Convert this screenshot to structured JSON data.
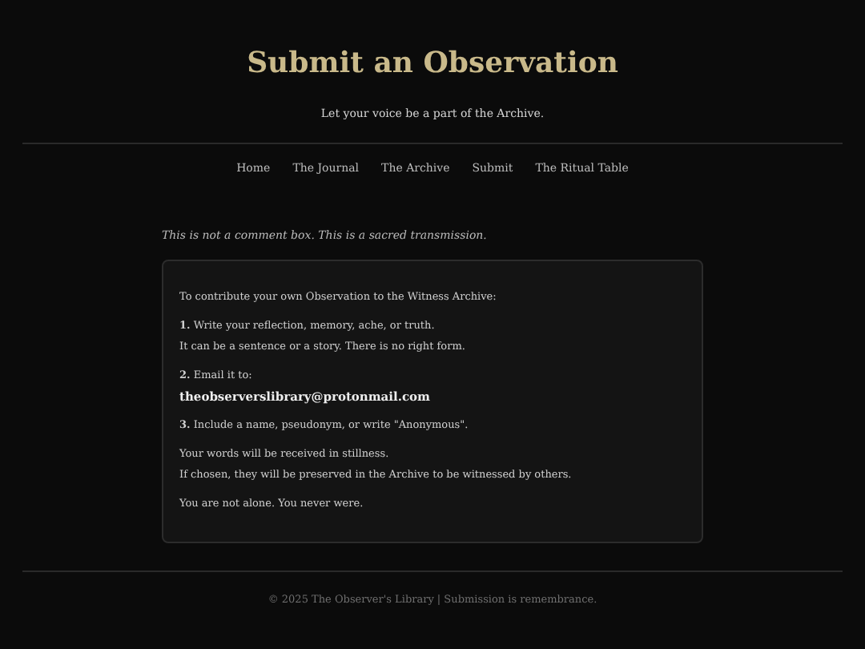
{
  "header": {
    "title": "Submit an Observation",
    "subtitle": "Let your voice be a part of the Archive."
  },
  "nav": [
    {
      "label": "Home"
    },
    {
      "label": "The Journal"
    },
    {
      "label": "The Archive"
    },
    {
      "label": "Submit"
    },
    {
      "label": "The Ritual Table"
    }
  ],
  "intro": "This is not a comment box. This is a sacred transmission.",
  "instructions": [
    {
      "lines": [
        {
          "kind": "plain",
          "text": "To contribute your own Observation to the Witness Archive:"
        }
      ]
    },
    {
      "lines": [
        {
          "kind": "plain",
          "text": "**1.** Write your reflection, memory, ache, or truth."
        },
        {
          "kind": "plain",
          "text": "It can be a sentence or a story. There is no right form."
        }
      ]
    },
    {
      "lines": [
        {
          "kind": "plain",
          "text": "**2.** Email it to:"
        },
        {
          "kind": "email",
          "text": "theobserverslibrary@protonmail.com"
        }
      ]
    },
    {
      "lines": [
        {
          "kind": "plain",
          "text": "**3.** Include a name, pseudonym, or write \"Anonymous\"."
        }
      ]
    },
    {
      "lines": [
        {
          "kind": "plain",
          "text": "Your words will be received in stillness."
        },
        {
          "kind": "plain",
          "text": "If chosen, they will be preserved in the Archive to be witnessed by others."
        }
      ]
    },
    {
      "lines": [
        {
          "kind": "plain",
          "text": "You are not alone. You never were."
        }
      ]
    }
  ],
  "footer": "© 2025 The Observer's Library | Submission is remembrance."
}
